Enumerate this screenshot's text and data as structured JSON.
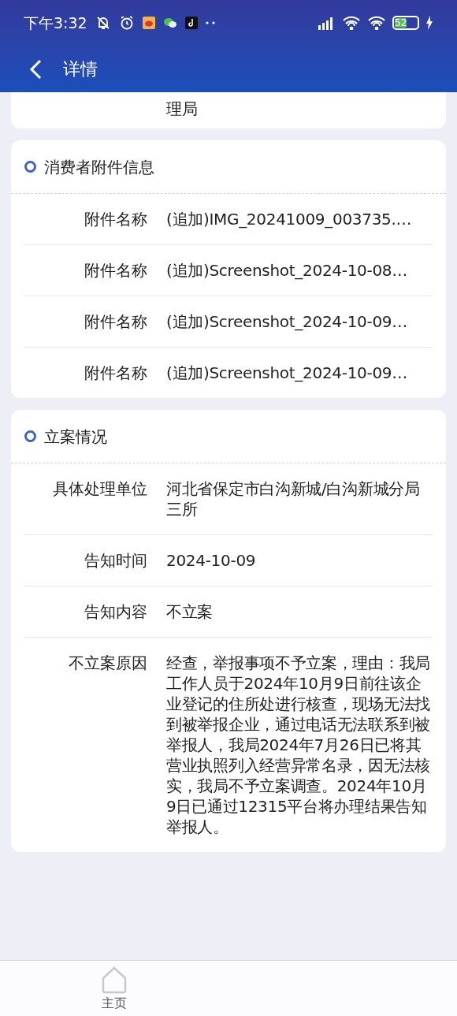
{
  "status_bar": {
    "time": "下午3:32",
    "battery": "52"
  },
  "header": {
    "title": "详情"
  },
  "top_card": {
    "value_tail": "理局"
  },
  "sections": [
    {
      "title": "消费者附件信息",
      "rows": [
        {
          "label": "附件名称",
          "value": "(追加)IMG_20241009_003735.…"
        },
        {
          "label": "附件名称",
          "value": "(追加)Screenshot_2024-10-08…"
        },
        {
          "label": "附件名称",
          "value": "(追加)Screenshot_2024-10-09…"
        },
        {
          "label": "附件名称",
          "value": "(追加)Screenshot_2024-10-09…"
        }
      ]
    },
    {
      "title": "立案情况",
      "rows": [
        {
          "label": "具体处理单位",
          "value": "河北省保定市白沟新城/白沟新城分局三所"
        },
        {
          "label": "告知时间",
          "value": "2024-10-09"
        },
        {
          "label": "告知内容",
          "value": "不立案"
        },
        {
          "label": "不立案原因",
          "value": "经查，举报事项不予立案，理由：我局工作人员于2024年10月9日前往该企业登记的住所处进行核查，现场无法找到被举报企业，通过电话无法联系到被举报人，我局2024年7月26日已将其营业执照列入经营异常名录，因无法核实，我局不予立案调查。2024年10月9日已通过12315平台将办理结果告知举报人。"
        }
      ]
    }
  ],
  "bottom_nav": [
    {
      "label": "主页"
    }
  ]
}
